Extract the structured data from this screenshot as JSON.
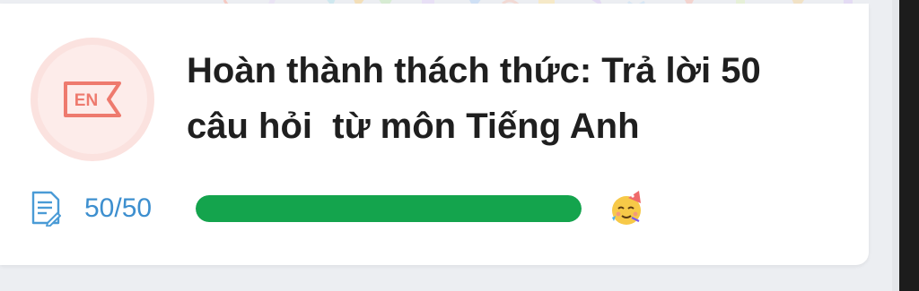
{
  "challenge": {
    "badge_text": "EN",
    "title": "Hoàn thành thách thức: Trả lời 50\ncâu hỏi  từ môn Tiếng Anh",
    "progress_text": "50/50",
    "progress_fraction": 1.0
  },
  "icons": {
    "badge": "english-flag-icon",
    "progress": "document-edit-icon",
    "celebration": "party-face-emoji-icon"
  },
  "colors": {
    "accent_text": "#3d8fcf",
    "progress_fill": "#14a44d",
    "badge_red": "#ee7a6e"
  }
}
